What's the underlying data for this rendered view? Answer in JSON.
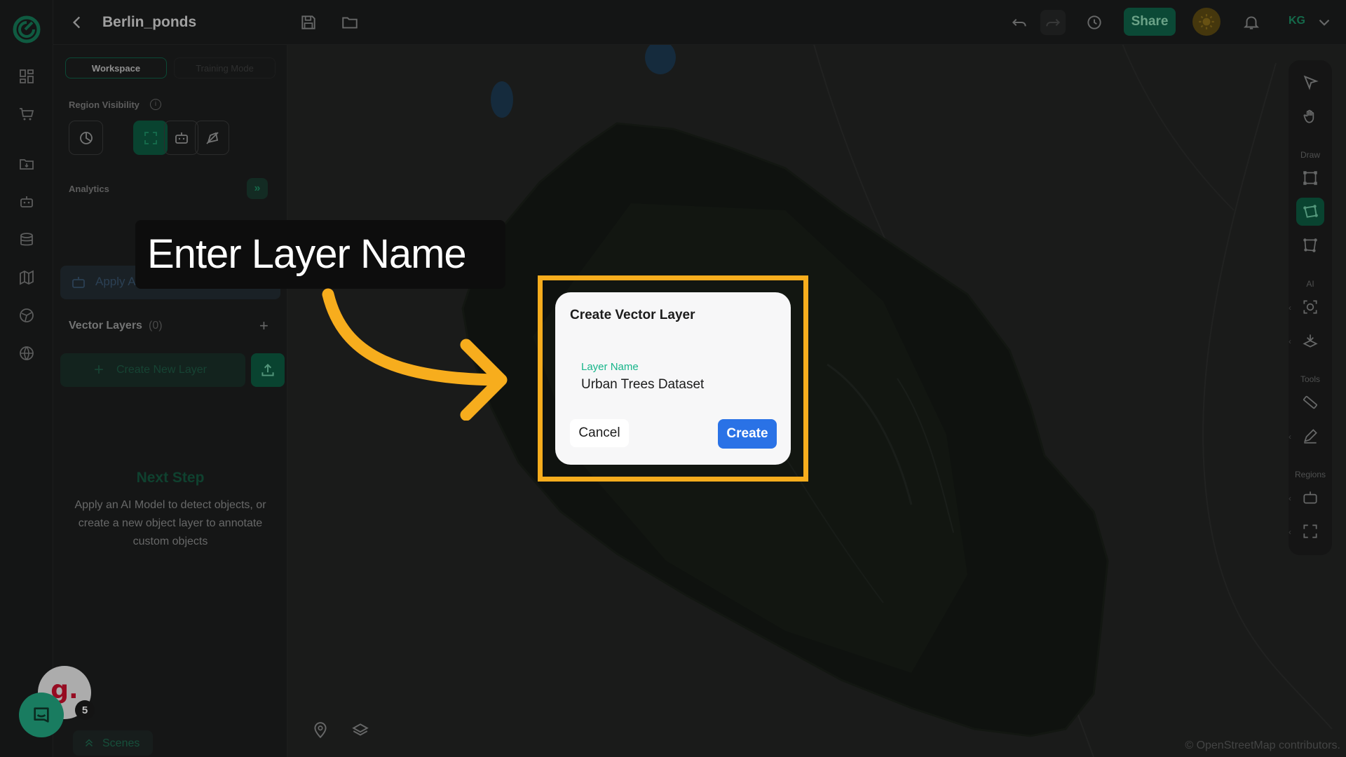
{
  "project": {
    "title": "Berlin_ponds"
  },
  "header": {
    "share_label": "Share",
    "user_initials": "KG"
  },
  "panel": {
    "tabs": [
      {
        "label": "Workspace",
        "active": true
      },
      {
        "label": "Training Mode",
        "active": false
      }
    ],
    "region_visibility_label": "Region Visibility",
    "analytics_label": "Analytics",
    "analytics_toggle": "»",
    "apply_model_label": "Apply AI Model",
    "vector_layers": {
      "title": "Vector Layers",
      "count": "(0)"
    },
    "create_layer_label": "Create New Layer",
    "next_step": {
      "title": "Next Step",
      "description": "Apply an AI Model to detect objects, or create a new object layer to annotate custom objects"
    },
    "scenes_label": "Scenes"
  },
  "toolstrip": {
    "sections": {
      "draw": "Draw",
      "ai": "AI",
      "tools": "Tools",
      "regions": "Regions"
    }
  },
  "map": {
    "credit": "© OpenStreetMap contributors."
  },
  "support": {
    "avatar_letter": "g.",
    "badge_count": "5"
  },
  "callout": {
    "text": "Enter Layer Name"
  },
  "modal": {
    "title": "Create Vector Layer",
    "field_label": "Layer Name",
    "field_value": "Urban Trees Dataset",
    "cancel_label": "Cancel",
    "create_label": "Create"
  },
  "colors": {
    "accent": "#0f6248",
    "highlight": "#f7ad1d",
    "primary_button": "#2a72e6",
    "field_label": "#16b58a"
  }
}
